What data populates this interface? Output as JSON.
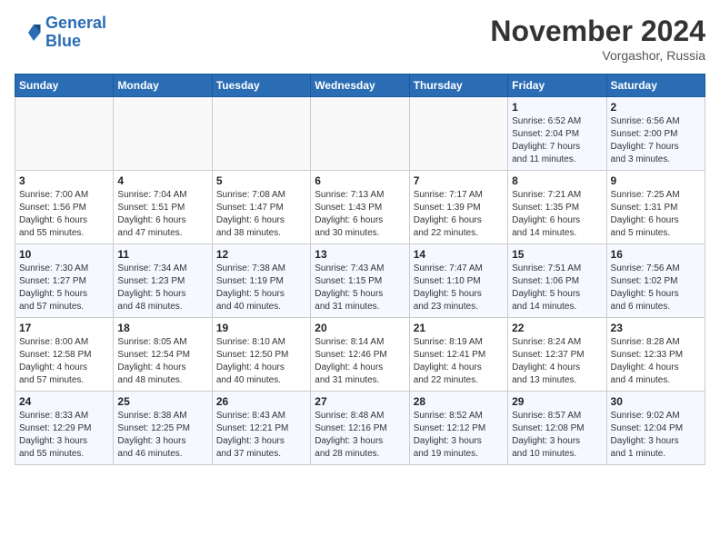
{
  "header": {
    "logo_line1": "General",
    "logo_line2": "Blue",
    "month_title": "November 2024",
    "location": "Vorgashor, Russia"
  },
  "weekdays": [
    "Sunday",
    "Monday",
    "Tuesday",
    "Wednesday",
    "Thursday",
    "Friday",
    "Saturday"
  ],
  "weeks": [
    [
      {
        "day": "",
        "info": ""
      },
      {
        "day": "",
        "info": ""
      },
      {
        "day": "",
        "info": ""
      },
      {
        "day": "",
        "info": ""
      },
      {
        "day": "",
        "info": ""
      },
      {
        "day": "1",
        "info": "Sunrise: 6:52 AM\nSunset: 2:04 PM\nDaylight: 7 hours\nand 11 minutes."
      },
      {
        "day": "2",
        "info": "Sunrise: 6:56 AM\nSunset: 2:00 PM\nDaylight: 7 hours\nand 3 minutes."
      }
    ],
    [
      {
        "day": "3",
        "info": "Sunrise: 7:00 AM\nSunset: 1:56 PM\nDaylight: 6 hours\nand 55 minutes."
      },
      {
        "day": "4",
        "info": "Sunrise: 7:04 AM\nSunset: 1:51 PM\nDaylight: 6 hours\nand 47 minutes."
      },
      {
        "day": "5",
        "info": "Sunrise: 7:08 AM\nSunset: 1:47 PM\nDaylight: 6 hours\nand 38 minutes."
      },
      {
        "day": "6",
        "info": "Sunrise: 7:13 AM\nSunset: 1:43 PM\nDaylight: 6 hours\nand 30 minutes."
      },
      {
        "day": "7",
        "info": "Sunrise: 7:17 AM\nSunset: 1:39 PM\nDaylight: 6 hours\nand 22 minutes."
      },
      {
        "day": "8",
        "info": "Sunrise: 7:21 AM\nSunset: 1:35 PM\nDaylight: 6 hours\nand 14 minutes."
      },
      {
        "day": "9",
        "info": "Sunrise: 7:25 AM\nSunset: 1:31 PM\nDaylight: 6 hours\nand 5 minutes."
      }
    ],
    [
      {
        "day": "10",
        "info": "Sunrise: 7:30 AM\nSunset: 1:27 PM\nDaylight: 5 hours\nand 57 minutes."
      },
      {
        "day": "11",
        "info": "Sunrise: 7:34 AM\nSunset: 1:23 PM\nDaylight: 5 hours\nand 48 minutes."
      },
      {
        "day": "12",
        "info": "Sunrise: 7:38 AM\nSunset: 1:19 PM\nDaylight: 5 hours\nand 40 minutes."
      },
      {
        "day": "13",
        "info": "Sunrise: 7:43 AM\nSunset: 1:15 PM\nDaylight: 5 hours\nand 31 minutes."
      },
      {
        "day": "14",
        "info": "Sunrise: 7:47 AM\nSunset: 1:10 PM\nDaylight: 5 hours\nand 23 minutes."
      },
      {
        "day": "15",
        "info": "Sunrise: 7:51 AM\nSunset: 1:06 PM\nDaylight: 5 hours\nand 14 minutes."
      },
      {
        "day": "16",
        "info": "Sunrise: 7:56 AM\nSunset: 1:02 PM\nDaylight: 5 hours\nand 6 minutes."
      }
    ],
    [
      {
        "day": "17",
        "info": "Sunrise: 8:00 AM\nSunset: 12:58 PM\nDaylight: 4 hours\nand 57 minutes."
      },
      {
        "day": "18",
        "info": "Sunrise: 8:05 AM\nSunset: 12:54 PM\nDaylight: 4 hours\nand 48 minutes."
      },
      {
        "day": "19",
        "info": "Sunrise: 8:10 AM\nSunset: 12:50 PM\nDaylight: 4 hours\nand 40 minutes."
      },
      {
        "day": "20",
        "info": "Sunrise: 8:14 AM\nSunset: 12:46 PM\nDaylight: 4 hours\nand 31 minutes."
      },
      {
        "day": "21",
        "info": "Sunrise: 8:19 AM\nSunset: 12:41 PM\nDaylight: 4 hours\nand 22 minutes."
      },
      {
        "day": "22",
        "info": "Sunrise: 8:24 AM\nSunset: 12:37 PM\nDaylight: 4 hours\nand 13 minutes."
      },
      {
        "day": "23",
        "info": "Sunrise: 8:28 AM\nSunset: 12:33 PM\nDaylight: 4 hours\nand 4 minutes."
      }
    ],
    [
      {
        "day": "24",
        "info": "Sunrise: 8:33 AM\nSunset: 12:29 PM\nDaylight: 3 hours\nand 55 minutes."
      },
      {
        "day": "25",
        "info": "Sunrise: 8:38 AM\nSunset: 12:25 PM\nDaylight: 3 hours\nand 46 minutes."
      },
      {
        "day": "26",
        "info": "Sunrise: 8:43 AM\nSunset: 12:21 PM\nDaylight: 3 hours\nand 37 minutes."
      },
      {
        "day": "27",
        "info": "Sunrise: 8:48 AM\nSunset: 12:16 PM\nDaylight: 3 hours\nand 28 minutes."
      },
      {
        "day": "28",
        "info": "Sunrise: 8:52 AM\nSunset: 12:12 PM\nDaylight: 3 hours\nand 19 minutes."
      },
      {
        "day": "29",
        "info": "Sunrise: 8:57 AM\nSunset: 12:08 PM\nDaylight: 3 hours\nand 10 minutes."
      },
      {
        "day": "30",
        "info": "Sunrise: 9:02 AM\nSunset: 12:04 PM\nDaylight: 3 hours\nand 1 minute."
      }
    ]
  ]
}
